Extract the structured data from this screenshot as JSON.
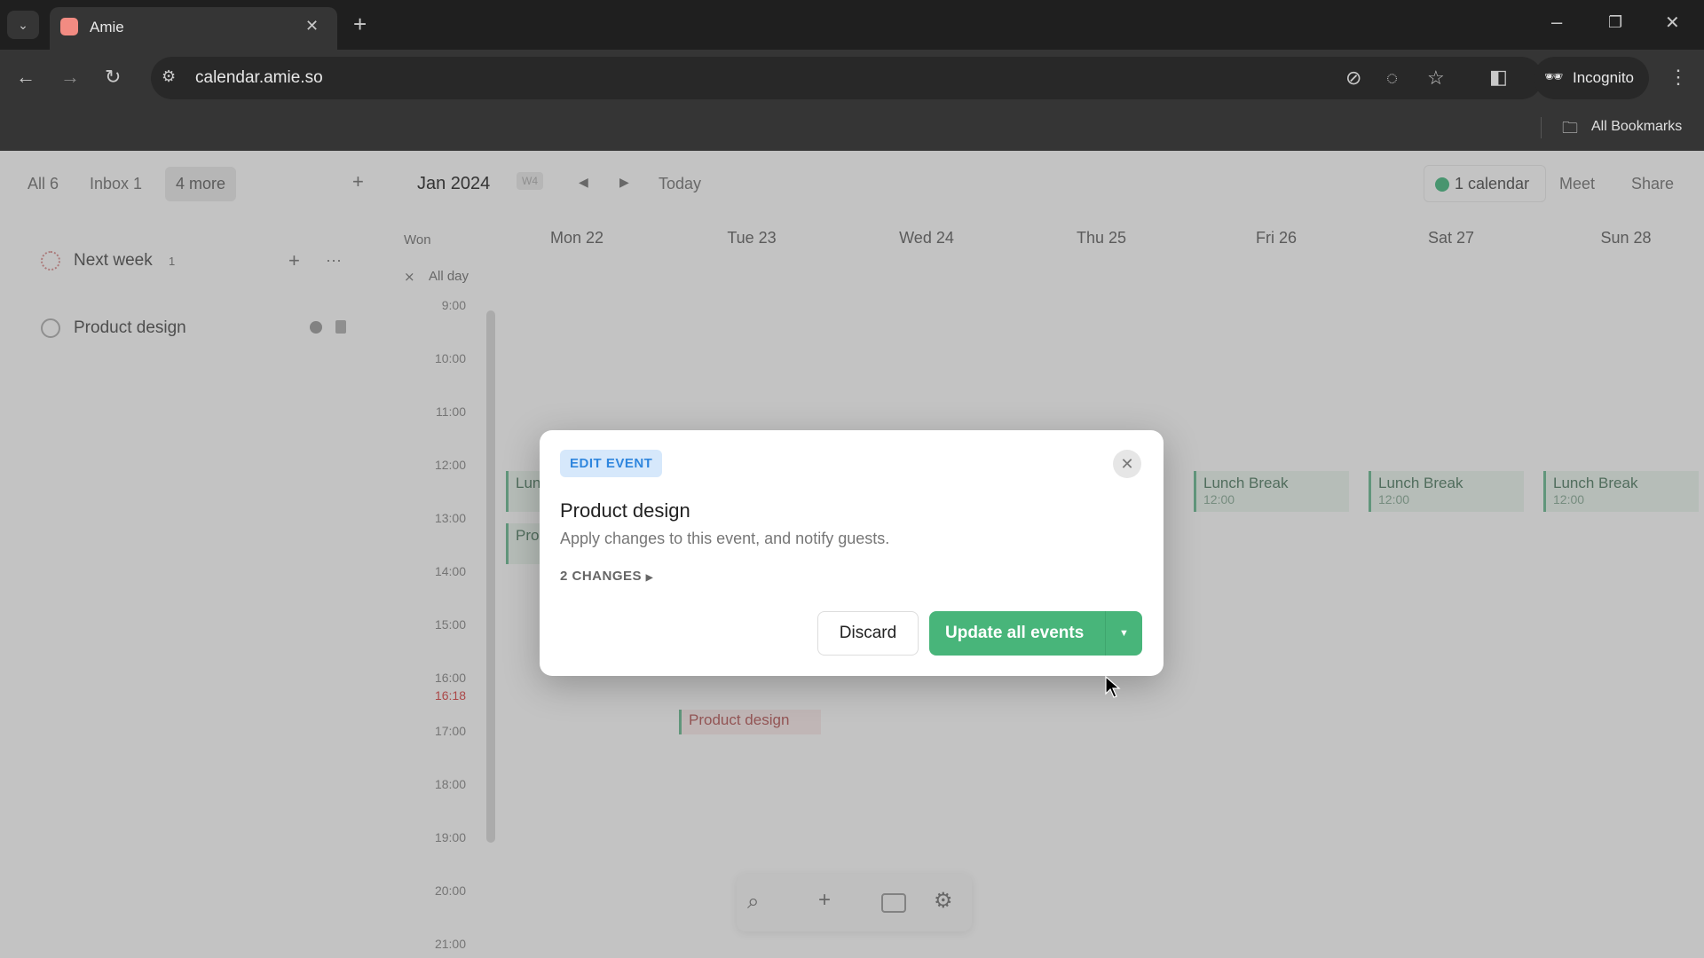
{
  "browser": {
    "tab_title": "Amie",
    "url": "calendar.amie.so",
    "profile": "Incognito",
    "bookmarks_label": "All Bookmarks"
  },
  "topbar": {
    "filters": [
      "All 6",
      "Inbox 1",
      "4 more"
    ],
    "month": "Jan 2024",
    "week_badge": "W4",
    "today": "Today",
    "calendar_count": "1 calendar",
    "meet": "Meet",
    "share": "Share",
    "calendar_color": "#5fc391"
  },
  "sidebar": {
    "section": "Next week",
    "section_count": "1",
    "items": [
      {
        "label": "Product design"
      }
    ]
  },
  "calendar": {
    "week_label": "Won",
    "all_day": "All day",
    "days": [
      "Mon 22",
      "Tue 23",
      "Wed 24",
      "Thu 25",
      "Fri 26",
      "Sat 27",
      "Sun 28"
    ],
    "hours": [
      "9:00",
      "10:00",
      "11:00",
      "12:00",
      "13:00",
      "14:00",
      "15:00",
      "16:00",
      "17:00",
      "18:00",
      "19:00",
      "20:00",
      "21:00"
    ],
    "now": "16:18",
    "events": {
      "lunch_title": "Lunch Break",
      "lunch_time": "12:00",
      "mon_partial_1": "Lun",
      "mon_partial_2": "Pro",
      "tue_event": "Product design"
    }
  },
  "modal": {
    "badge": "EDIT EVENT",
    "title": "Product design",
    "subtitle": "Apply changes to this event, and notify guests.",
    "changes": "2 CHANGES",
    "discard": "Discard",
    "update": "Update all events",
    "accent": "#48b57a"
  }
}
